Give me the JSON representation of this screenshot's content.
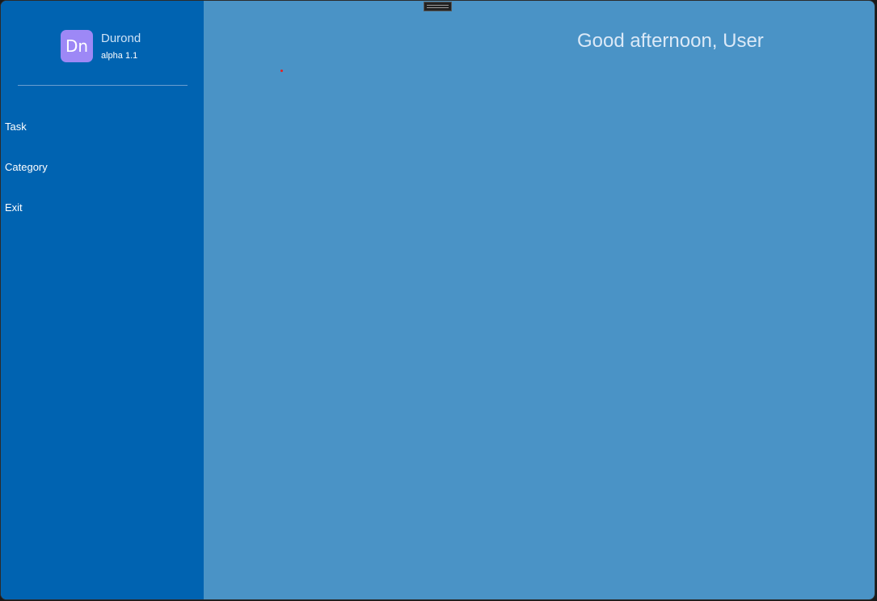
{
  "app": {
    "logo_text": "Dn",
    "name": "Durond",
    "version": "alpha 1.1"
  },
  "sidebar": {
    "items": [
      {
        "label": "Task"
      },
      {
        "label": "Category"
      },
      {
        "label": "Exit"
      }
    ]
  },
  "main": {
    "greeting": "Good afternoon, User"
  },
  "colors": {
    "sidebar_bg": "#0063b1",
    "main_bg": "#4a93c6",
    "logo_bg": "#9d88f6"
  }
}
